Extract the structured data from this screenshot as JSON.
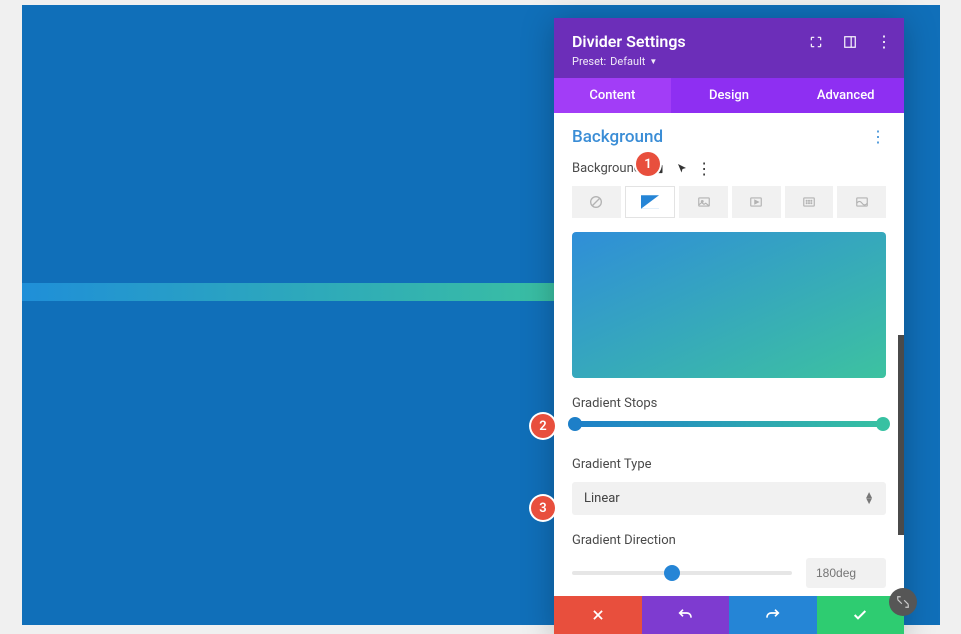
{
  "panel": {
    "title": "Divider Settings",
    "preset_label": "Preset:",
    "preset_value": "Default"
  },
  "tabs": {
    "content": "Content",
    "design": "Design",
    "advanced": "Advanced"
  },
  "section": {
    "title": "Background"
  },
  "background": {
    "label": "Background",
    "types": {
      "color": "color",
      "gradient": "gradient",
      "image": "image",
      "video": "video",
      "pattern": "pattern",
      "mask": "mask"
    }
  },
  "gradient": {
    "stops_label": "Gradient Stops",
    "type_label": "Gradient Type",
    "type_value": "Linear",
    "direction_label": "Gradient Direction",
    "direction_value": "180deg",
    "stop_left_color": "#1d7fc8",
    "stop_right_color": "#37c1a2"
  },
  "callouts": {
    "c1": "1",
    "c2": "2",
    "c3": "3"
  }
}
